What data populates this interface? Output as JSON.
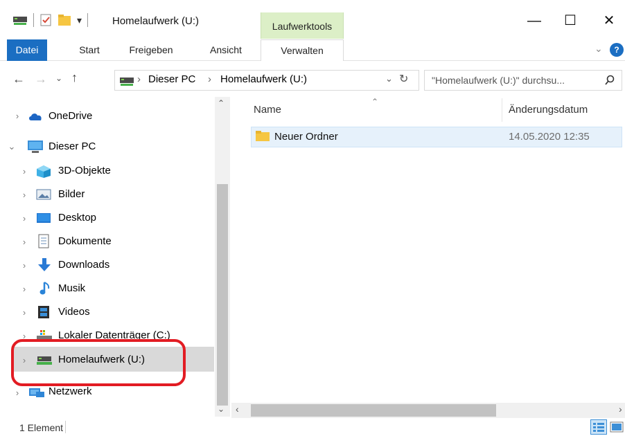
{
  "titlebar": {
    "title": "Homelaufwerk (U:)",
    "context_tab": "Laufwerktools",
    "min_glyph": "—",
    "max_glyph": "☐",
    "close_glyph": "✕"
  },
  "ribbon": {
    "tabs": [
      "Datei",
      "Start",
      "Freigeben",
      "Ansicht",
      "Verwalten"
    ],
    "collapse_glyph": "⌄"
  },
  "address": {
    "crumbs": [
      "Dieser PC",
      "Homelaufwerk (U:)"
    ],
    "sep": "›",
    "search_placeholder": "\"Homelaufwerk (U:)\" durchsu..."
  },
  "nav": {
    "items": [
      {
        "label": "OneDrive",
        "icon": "cloud-icon",
        "expanded": false
      },
      {
        "label": "Dieser PC",
        "icon": "computer-icon",
        "expanded": true
      },
      {
        "label": "3D-Objekte",
        "icon": "cube-icon"
      },
      {
        "label": "Bilder",
        "icon": "image-icon"
      },
      {
        "label": "Desktop",
        "icon": "desktop-icon"
      },
      {
        "label": "Dokumente",
        "icon": "document-icon"
      },
      {
        "label": "Downloads",
        "icon": "download-icon"
      },
      {
        "label": "Musik",
        "icon": "music-icon"
      },
      {
        "label": "Videos",
        "icon": "video-icon"
      },
      {
        "label": "Lokaler Datenträger (C:)",
        "icon": "drive-icon"
      },
      {
        "label": "Homelaufwerk (U:)",
        "icon": "network-drive-icon",
        "selected": true
      },
      {
        "label": "Netzwerk",
        "icon": "network-icon"
      }
    ]
  },
  "files": {
    "columns": [
      "Name",
      "Änderungsdatum"
    ],
    "rows": [
      {
        "name": "Neuer Ordner",
        "date": "14.05.2020 12:35"
      }
    ]
  },
  "status": {
    "count": "1 Element"
  },
  "colors": {
    "accent": "#1b6ec2",
    "context_tab": "#dcefc7",
    "highlight": "#e21c23"
  }
}
